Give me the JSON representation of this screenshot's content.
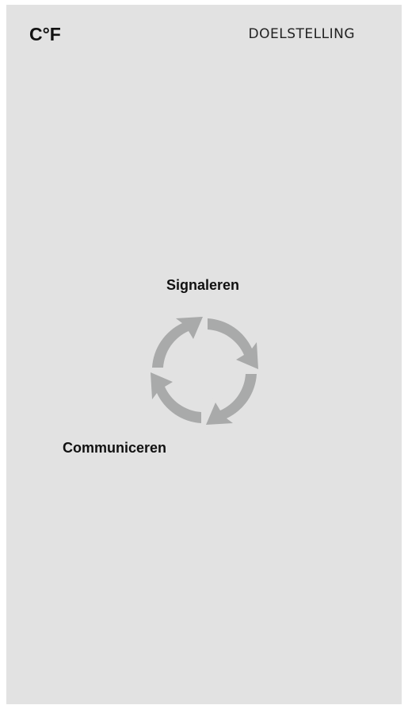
{
  "header": {
    "logo": "C°F",
    "menu_title": "DOELSTELLING"
  },
  "cycle": {
    "icon": "cycle-arrows-icon",
    "color": "#a9aaaa",
    "labels": {
      "top": "Signaleren",
      "bottom": "Communiceren"
    }
  },
  "colors": {
    "background": "#e2e2e2",
    "text": "#111111"
  }
}
